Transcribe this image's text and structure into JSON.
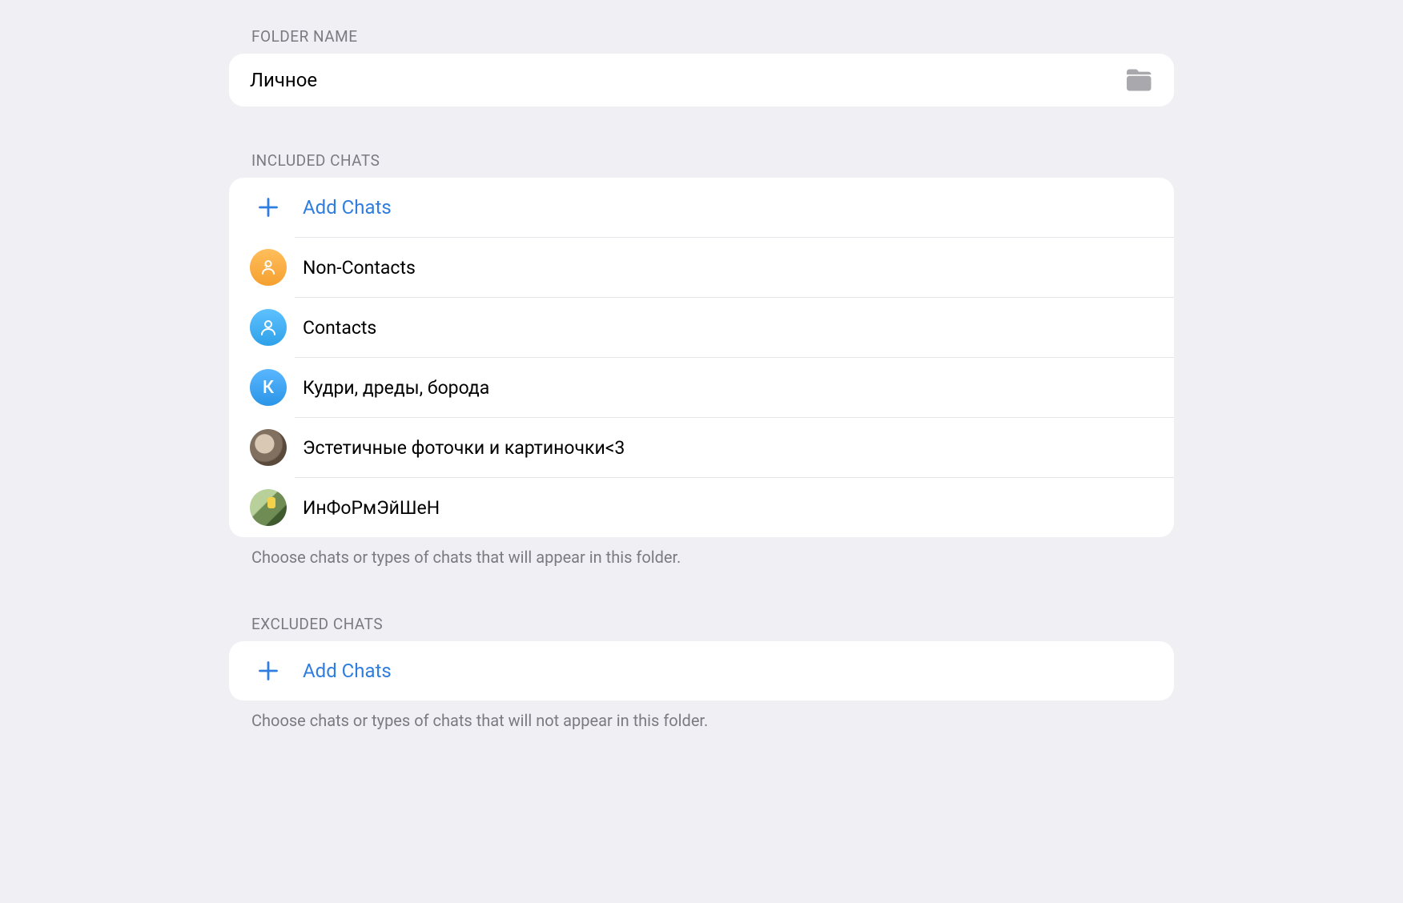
{
  "folderName": {
    "sectionLabel": "FOLDER NAME",
    "value": "Личное"
  },
  "included": {
    "sectionLabel": "INCLUDED CHATS",
    "addLabel": "Add Chats",
    "items": [
      {
        "label": "Non-Contacts",
        "avatar": "non-contacts"
      },
      {
        "label": "Contacts",
        "avatar": "contacts"
      },
      {
        "label": "Кудри, дреды, борода",
        "avatar": "letter-k"
      },
      {
        "label": "Эстетичные фоточки и картиночки<3",
        "avatar": "photo1"
      },
      {
        "label": "ИнФоРмЭйШеН",
        "avatar": "photo2"
      }
    ],
    "description": "Choose chats or types of chats that will appear in this folder."
  },
  "excluded": {
    "sectionLabel": "EXCLUDED CHATS",
    "addLabel": "Add Chats",
    "description": "Choose chats or types of chats that will not appear in this folder."
  }
}
